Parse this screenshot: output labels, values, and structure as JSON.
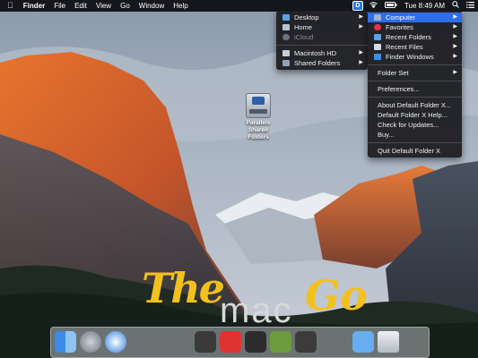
{
  "menubar": {
    "apple": "",
    "app_name": "Finder",
    "items": [
      "File",
      "Edit",
      "View",
      "Go",
      "Window",
      "Help"
    ],
    "clock": "Tue 8:49 AM",
    "status_icons": [
      "default-folder-x-icon",
      "wifi-icon",
      "battery-icon",
      "search-icon",
      "list-icon"
    ]
  },
  "submenu": {
    "items": [
      {
        "label": "Desktop",
        "icon": "folder-icon",
        "arrow": "▶"
      },
      {
        "label": "Home",
        "icon": "home-icon",
        "arrow": "▶"
      },
      {
        "label": "iCloud",
        "icon": "cloud-icon"
      },
      {
        "label": "Macintosh HD",
        "icon": "disk-icon",
        "arrow": "▶"
      },
      {
        "label": "Shared Folders",
        "icon": "shared-folder-icon",
        "arrow": "▶"
      }
    ]
  },
  "dfx_menu": {
    "top_items": [
      {
        "label": "Computer",
        "arrow": "▶"
      },
      {
        "label": "Favorites",
        "arrow": "▶"
      },
      {
        "label": "Recent Folders",
        "arrow": "▶"
      },
      {
        "label": "Recent Files",
        "arrow": "▶"
      },
      {
        "label": "Finder Windows",
        "arrow": "▶"
      }
    ],
    "folder_set": "Folder Set",
    "preferences": "Preferences...",
    "about": "About Default Folder X...",
    "help": "Default Folder X Help...",
    "updates": "Check for Updates...",
    "buy": "Buy...",
    "quit": "Quit Default Folder X"
  },
  "desktop_icon": {
    "label": "Parallels Shared Folders"
  },
  "watermark": {
    "the": "The",
    "mac": "mac",
    "go": "Go"
  },
  "dock": {
    "apps": [
      "finder-icon",
      "launchpad-icon",
      "safari-icon",
      "trash-icon",
      "downloads-folder-icon"
    ]
  },
  "colors": {
    "highlight": "#2f6ee6",
    "menu_bg": "#1e1e22",
    "watermark": "#f2c11d"
  }
}
